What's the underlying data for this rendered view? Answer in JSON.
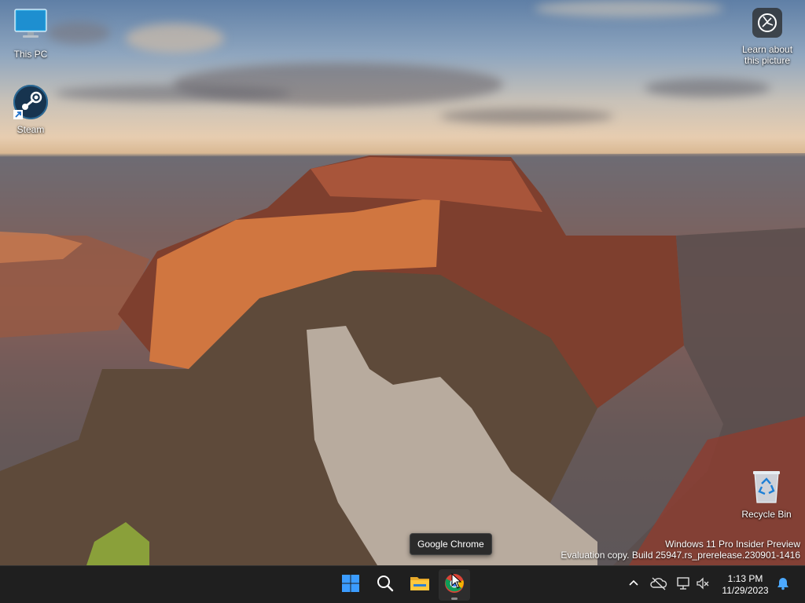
{
  "desktop": {
    "icons": [
      {
        "label": "This PC"
      },
      {
        "label": "Steam"
      },
      {
        "label": "Recycle Bin"
      }
    ],
    "learn_picture": {
      "line1": "Learn about",
      "line2": "this picture"
    },
    "watermark": {
      "line1": "Windows 11 Pro Insider Preview",
      "line2": "Evaluation copy. Build 25947.rs_prerelease.230901-1416"
    },
    "tooltip": "Google Chrome"
  },
  "taskbar": {
    "apps": [
      {
        "name": "start-button"
      },
      {
        "name": "search-button"
      },
      {
        "name": "file-explorer-button"
      },
      {
        "name": "google-chrome-button",
        "active": true
      }
    ],
    "clock": {
      "time": "1:13 PM",
      "date": "11/29/2023"
    }
  },
  "colors": {
    "taskbar_bg": "#1f1f1f",
    "start_blue": "#3b9cff",
    "notification_blue": "#4ca9ff"
  }
}
